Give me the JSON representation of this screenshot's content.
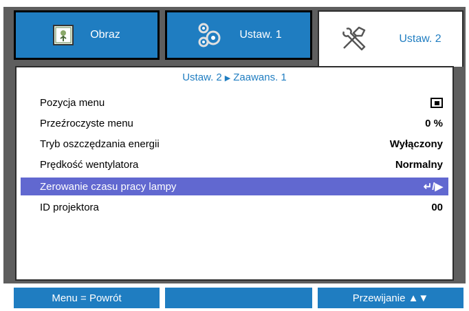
{
  "tabs": [
    {
      "label": "Obraz",
      "icon": "image-icon"
    },
    {
      "label": "Ustaw. 1",
      "icon": "gears-icon"
    },
    {
      "label": "Ustaw. 2",
      "icon": "tools-icon"
    }
  ],
  "breadcrumb": {
    "parent": "Ustaw. 2",
    "current": "Zaawans. 1"
  },
  "menu": [
    {
      "label": "Pozycja menu",
      "value": ""
    },
    {
      "label": "Przeźroczyste menu",
      "value": "0 %"
    },
    {
      "label": "Tryb oszczędzania energii",
      "value": "Wyłączony"
    },
    {
      "label": "Prędkość wentylatora",
      "value": "Normalny"
    },
    {
      "label": "Zerowanie czasu pracy lampy",
      "value": "↵/▶"
    },
    {
      "label": "ID projektora",
      "value": "00"
    }
  ],
  "footer": {
    "left": "Menu = Powrót",
    "middle": "",
    "right": "Przewijanie ▲▼"
  },
  "colors": {
    "accent": "#1f7dc1",
    "selected": "#6168d0",
    "frame": "#5e5e5e"
  }
}
